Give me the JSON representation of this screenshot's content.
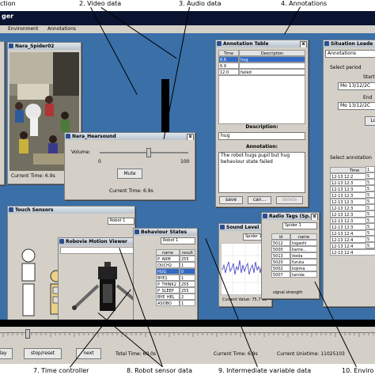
{
  "captions_top": [
    "ction",
    "2. Video data",
    "3. Audio data",
    "4. Annotations"
  ],
  "captions_bottom": [
    "7. Time controller",
    "8. Robot sensor data",
    "9. Intermediate variable data",
    "10. Enviro"
  ],
  "app": {
    "title_fragment": "ger"
  },
  "menu": {
    "items": [
      "Environment",
      "Annotations"
    ]
  },
  "video_window": {
    "title": "Nara_Spider02",
    "current_time": "Current Time: 6.9s"
  },
  "audio_window": {
    "title": "Nara_Hearsound",
    "volume_label": "Volume:",
    "volume_min": "0",
    "volume_max": "100",
    "volume_level": 0.55,
    "mute_label": "Mute",
    "current_time": "Current Time: 6.9s"
  },
  "annotation_table": {
    "title": "Annotation Table",
    "columns": [
      "Time",
      "Description"
    ],
    "rows": [
      {
        "time": "6.8",
        "description": "hug"
      },
      {
        "time": "6.9",
        "description": ""
      },
      {
        "time": "12.0",
        "description": "failed"
      }
    ],
    "description_label": "Description:",
    "description_value": "hug",
    "annotation_label": "Annotation:",
    "annotation_text": "The robot hugs pupil but hug behaviour state failed",
    "buttons": [
      "save",
      "can...",
      "delete"
    ]
  },
  "situation_loader": {
    "title": "Situation Loade",
    "dropdown_value": "Annotations",
    "period_label": "Select period",
    "start_label": "Start",
    "start_value": "Mo 13/12/2C",
    "end_label": "End",
    "end_value": "Mo 13/12/2C",
    "load_label": "Lo",
    "annotation_label": "Select annotation",
    "time_header": "Time",
    "times": [
      "12-13 12:2",
      "12-13 12:3",
      "12-13 12:3",
      "12-13 12:3",
      "12-13 12:3",
      "12-13 12:3",
      "12-13 12:3",
      "12-13 12:3",
      "12-13 12:3",
      "12-13 12:4",
      "12-13 12:4",
      "12-13 12:4",
      "12-13 12:4"
    ],
    "right_edge_values": [
      "1",
      "5",
      "5",
      "5",
      "5",
      "5",
      "5",
      "5",
      "5",
      "5",
      "5",
      "5",
      "5"
    ]
  },
  "touch_window": {
    "title": "Touch Sensors",
    "robot_value": "Robot 1"
  },
  "motion_window": {
    "title": "Robovie Motion Viewer"
  },
  "behaviour_window": {
    "title": "Behaviour States",
    "robot_value": "Robot 1",
    "columns": [
      "name",
      "result"
    ],
    "rows": [
      {
        "name": "P_ARM",
        "result": "255"
      },
      {
        "name": "OUCH2",
        "result": "1"
      },
      {
        "name": "HUG",
        "result": "0"
      },
      {
        "name": "BYE1",
        "result": "1"
      },
      {
        "name": "P_THINK2",
        "result": "255"
      },
      {
        "name": "P_SLEEP",
        "result": "255"
      },
      {
        "name": "BYE_HEL",
        "result": "2"
      },
      {
        "name": "ASOBO",
        "result": "1"
      }
    ]
  },
  "sound_window": {
    "title": "Sound Level ...",
    "spider_value": "Spider 1",
    "current_value": "Current Value: 75.7 db"
  },
  "radio_window": {
    "title": "Radio Tags (Sp...",
    "spider_value": "Spider 1",
    "columns": [
      "id",
      "name"
    ],
    "rows": [
      {
        "id": "5012",
        "name": "togashi"
      },
      {
        "id": "5000",
        "name": "kame..."
      },
      {
        "id": "5013",
        "name": "ikeda"
      },
      {
        "id": "5020",
        "name": "furuta"
      },
      {
        "id": "5002",
        "name": "kojima"
      },
      {
        "id": "5007",
        "name": "tanida"
      }
    ],
    "signal_label": "signal strength"
  },
  "controller": {
    "play_label": "lay",
    "stop_label": "stop/reset",
    "next_label": "next",
    "total_time": "Total Time: 60.0s",
    "current_time": "Current Time: 6.9s",
    "unix_time": "Current Unixtime: 11025103",
    "slider_position": 0.06
  },
  "colors": {
    "desktop": "#3a6fa8",
    "selection": "#316ac5",
    "window": "#d4d0c8"
  },
  "icons": [
    "window-icon",
    "close-icon",
    "slider-thumb-icon",
    "robot-figure-icon"
  ]
}
